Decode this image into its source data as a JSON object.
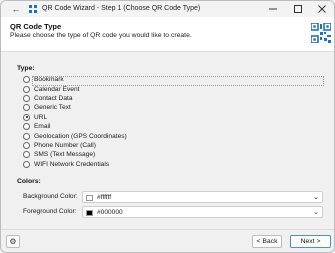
{
  "window": {
    "title": "QR Code Wizard - Step 1 (Choose QR Code Type)"
  },
  "header": {
    "heading": "QR Code Type",
    "description": "Please choose the type of QR code you would like to create."
  },
  "type_section": {
    "label": "Type:",
    "options": [
      {
        "label": "Bookmark",
        "checked": false
      },
      {
        "label": "Calendar Event",
        "checked": false
      },
      {
        "label": "Contact Data",
        "checked": false
      },
      {
        "label": "Generic Text",
        "checked": false
      },
      {
        "label": "URL",
        "checked": true
      },
      {
        "label": "Email",
        "checked": false
      },
      {
        "label": "Geolocation (GPS Coordinates)",
        "checked": false
      },
      {
        "label": "Phone Number (Call)",
        "checked": false
      },
      {
        "label": "SMS (Text Message)",
        "checked": false
      },
      {
        "label": "WIFI Network Credentials",
        "checked": false
      }
    ]
  },
  "colors_section": {
    "label": "Colors:",
    "background": {
      "label": "Background Color:",
      "value": "#ffffff"
    },
    "foreground": {
      "label": "Foreground Color:",
      "value": "#000000"
    }
  },
  "footer": {
    "back_label": "< Back",
    "next_label": "Next >"
  },
  "icons": {
    "back": "arrow-left-icon",
    "minimize": "minimize-icon",
    "maximize": "maximize-icon",
    "close": "close-icon",
    "settings": "gear-icon",
    "logo": "qr-code-icon"
  },
  "colors": {
    "accent": "#1e73be",
    "primary_border": "#4a90d9"
  }
}
